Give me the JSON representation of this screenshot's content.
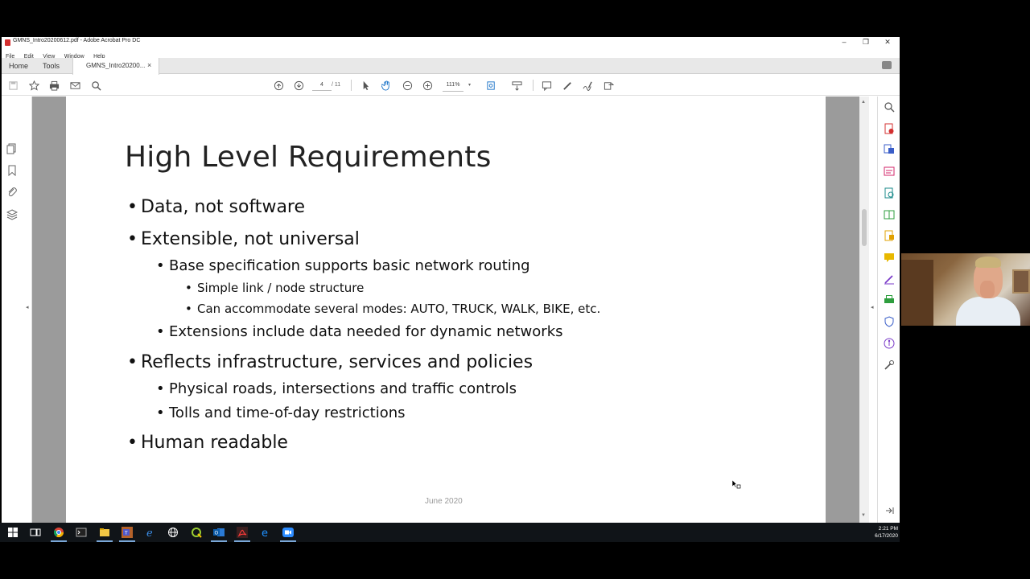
{
  "window": {
    "title": "GMNS_Intro20200612.pdf - Adobe Acrobat Pro DC",
    "minimize": "–",
    "restore": "❐",
    "close": "✕"
  },
  "menu": [
    "File",
    "Edit",
    "View",
    "Window",
    "Help"
  ],
  "tabs": {
    "home": "Home",
    "tools": "Tools",
    "document": "GMNS_Intro20200...",
    "close": "×"
  },
  "toolbar": {
    "page_current": "4",
    "page_total": "/ 11",
    "zoom": "111%",
    "zoom_arrow": "▾"
  },
  "slide": {
    "title": "High Level Requirements",
    "bullets": [
      {
        "level": 1,
        "text": "Data, not software"
      },
      {
        "level": 1,
        "text": "Extensible, not universal"
      },
      {
        "level": 2,
        "text": "Base specification supports basic network routing"
      },
      {
        "level": 3,
        "text": "Simple link / node structure"
      },
      {
        "level": 3,
        "text": "Can accommodate several modes:  AUTO, TRUCK, WALK, BIKE, etc."
      },
      {
        "level": 2,
        "text": "Extensions include data needed for dynamic networks"
      },
      {
        "level": 1,
        "text": "Reflects infrastructure, services and policies"
      },
      {
        "level": 2,
        "text": "Physical roads, intersections and traffic controls"
      },
      {
        "level": 2,
        "text": "Tolls and time-of-day restrictions"
      },
      {
        "level": 1,
        "text": "Human readable"
      }
    ],
    "bullet_glyph": "•",
    "footer": "June 2020"
  },
  "taskbar": {
    "time": "2:21 PM",
    "date": "6/17/2020"
  },
  "colors": {
    "acrobat_red": "#d32f2f",
    "doc_background": "#9b9b9b",
    "taskbar": "#101418"
  }
}
